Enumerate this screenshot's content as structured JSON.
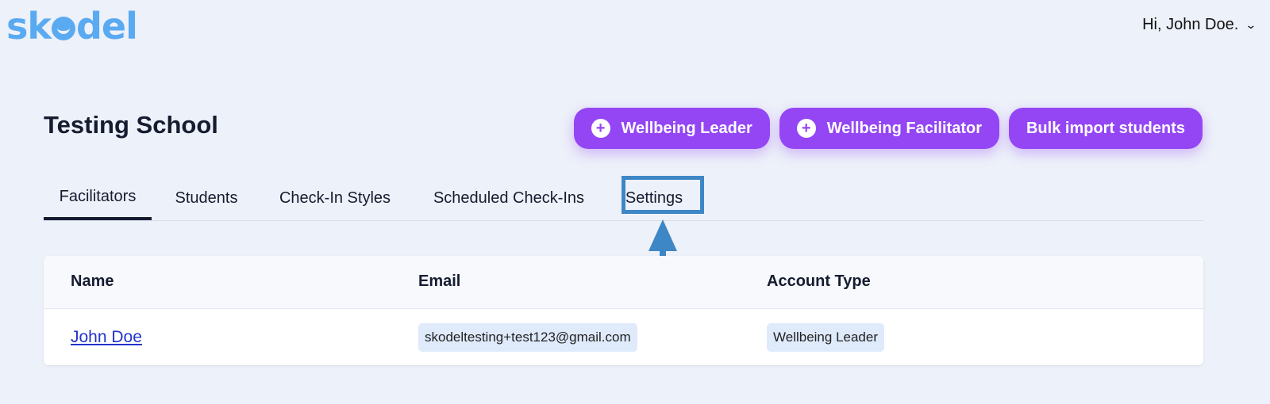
{
  "header": {
    "logo": {
      "left": "sk",
      "right": "del"
    },
    "greeting": "Hi, John Doe."
  },
  "school": {
    "name": "Testing School"
  },
  "actions": [
    {
      "label": "Wellbeing Leader",
      "icon": "plus-circle-icon"
    },
    {
      "label": "Wellbeing Facilitator",
      "icon": "plus-circle-icon"
    },
    {
      "label": "Bulk import students"
    }
  ],
  "tabs": [
    {
      "label": "Facilitators",
      "active": true
    },
    {
      "label": "Students"
    },
    {
      "label": "Check-In Styles"
    },
    {
      "label": "Scheduled Check-Ins"
    },
    {
      "label": "Settings"
    }
  ],
  "table": {
    "columns": [
      "Name",
      "Email",
      "Account Type"
    ],
    "rows": [
      {
        "name": "John Doe",
        "email": "skodeltesting+test123@gmail.com",
        "account_type": "Wellbeing Leader"
      }
    ]
  },
  "colors": {
    "brand": "#5aaaf2",
    "accent": "#9446f5",
    "annotation": "#3d87c6",
    "background": "#edf1f9"
  }
}
